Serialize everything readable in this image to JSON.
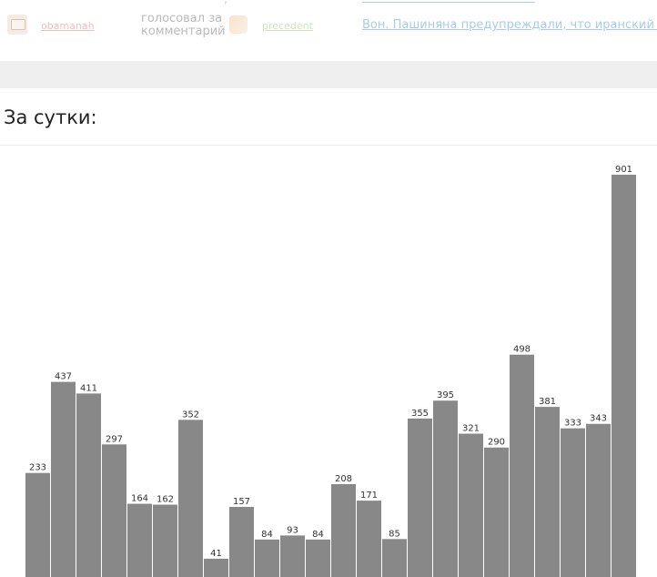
{
  "activity": {
    "top_fragment": ",",
    "user1": "obamanah",
    "action": "голосовал за комментарий",
    "user2": "precedent",
    "comment_link": "Вон. Пашиняна предупреждали, что иранский газ до"
  },
  "section": {
    "title": "За сутки:"
  },
  "chart_data": {
    "type": "bar",
    "title": "",
    "values": [
      233,
      437,
      411,
      297,
      164,
      162,
      352,
      41,
      157,
      84,
      93,
      84,
      208,
      171,
      85,
      355,
      395,
      321,
      290,
      498,
      381,
      333,
      343,
      901
    ],
    "labels": [
      "233",
      "437",
      "411",
      "297",
      "164",
      "162",
      "352",
      "41",
      "157",
      "84",
      "93",
      "84",
      "208",
      "171",
      "85",
      "355",
      "395",
      "321",
      "290",
      "498",
      "381",
      "333",
      "343",
      "901"
    ],
    "ylim": [
      0,
      901
    ],
    "grid": false,
    "bar_color": "#888888"
  }
}
